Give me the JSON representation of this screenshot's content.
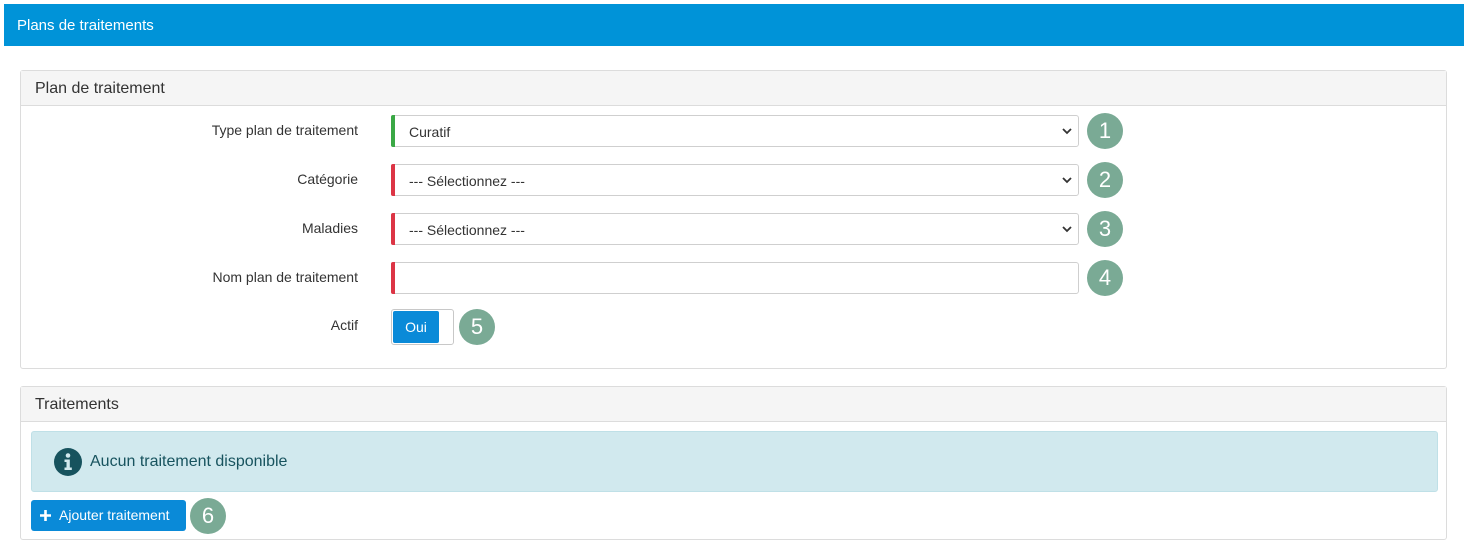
{
  "header": {
    "title": "Plans de traitements"
  },
  "plan": {
    "section_title": "Plan de traitement",
    "fields": [
      {
        "label": "Type plan de traitement",
        "value": "Curatif",
        "status": "valid",
        "step": "1"
      },
      {
        "label": "Catégorie",
        "value": "--- Sélectionnez ---",
        "status": "required",
        "step": "2"
      },
      {
        "label": "Maladies",
        "value": "--- Sélectionnez ---",
        "status": "required",
        "step": "3"
      },
      {
        "label": "Nom plan de traitement",
        "value": "",
        "status": "required",
        "step": "4"
      }
    ],
    "actif": {
      "label": "Actif",
      "value": "Oui",
      "step": "5"
    }
  },
  "treatments": {
    "section_title": "Traitements",
    "empty_message": "Aucun traitement disponible",
    "add_button_label": "Ajouter traitement",
    "add_step": "6"
  },
  "colors": {
    "header_bg": "#0093d8",
    "valid": "#3aa845",
    "required": "#dc3545",
    "badge": "#7aaa95",
    "primary_button": "#0a8ad8",
    "info_bg": "#d1e9ee"
  },
  "icons": {
    "select_arrow": "chevron-down-icon",
    "info": "info-circle-icon",
    "add": "plus-icon"
  }
}
